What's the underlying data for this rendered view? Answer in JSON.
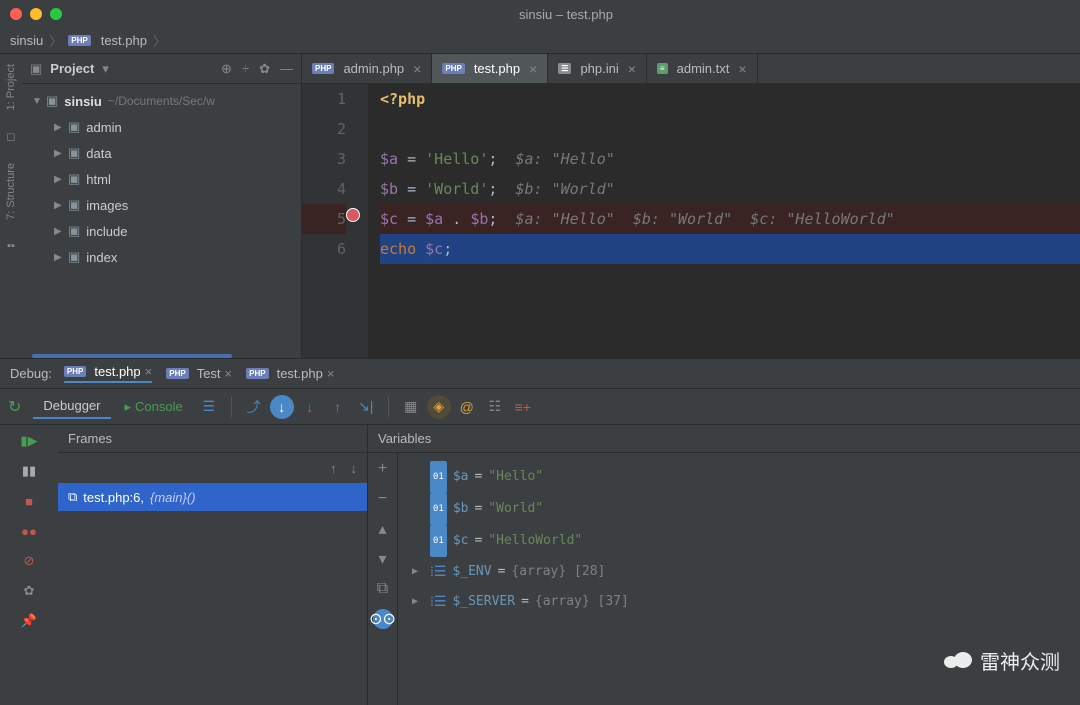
{
  "window": {
    "title": "sinsiu – test.php"
  },
  "breadcrumb": {
    "root": "sinsiu",
    "file": "test.php"
  },
  "project": {
    "panel_label": "Project",
    "root_name": "sinsiu",
    "root_path": "~/Documents/Sec/w",
    "folders": [
      "admin",
      "data",
      "html",
      "images",
      "include",
      "index"
    ]
  },
  "sidebar_strip": {
    "project": "1: Project",
    "structure": "7: Structure"
  },
  "editor_tabs": [
    {
      "label": "admin.php",
      "type": "php",
      "active": false
    },
    {
      "label": "test.php",
      "type": "php",
      "active": true
    },
    {
      "label": "php.ini",
      "type": "ini",
      "active": false
    },
    {
      "label": "admin.txt",
      "type": "txt",
      "active": false
    }
  ],
  "code": {
    "lines": [
      {
        "n": 1,
        "tag": "<?php"
      },
      {
        "n": 2,
        "raw": ""
      },
      {
        "n": 3,
        "var": "$a",
        "eq": " = ",
        "str": "'Hello'",
        "semi": ";",
        "hint": "  $a: \"Hello\""
      },
      {
        "n": 4,
        "var": "$b",
        "eq": " = ",
        "str": "'World'",
        "semi": ";",
        "hint": "  $b: \"World\""
      },
      {
        "n": 5,
        "bp": true,
        "var": "$c",
        "eq": " = ",
        "exprv1": "$a",
        "dot": " . ",
        "exprv2": "$b",
        "semi": ";",
        "hint": "  $a: \"Hello\"  $b: \"World\"  $c: \"HelloWorld\""
      },
      {
        "n": 6,
        "cur": true,
        "kw": "echo ",
        "var": "$c",
        "semi": ";"
      }
    ]
  },
  "debug": {
    "label": "Debug:",
    "tabs": [
      {
        "label": "test.php",
        "type": "php",
        "active": true
      },
      {
        "label": "Test",
        "type": "php",
        "active": false
      },
      {
        "label": "test.php",
        "type": "php",
        "active": false
      }
    ],
    "subtabs": {
      "debugger": "Debugger",
      "console": "Console"
    },
    "frames_label": "Frames",
    "variables_label": "Variables",
    "frame": {
      "file": "test.php:6,",
      "func": "{main}()"
    },
    "vars": [
      {
        "kind": "prim",
        "name": "$a",
        "value": "\"Hello\""
      },
      {
        "kind": "prim",
        "name": "$b",
        "value": "\"World\""
      },
      {
        "kind": "prim",
        "name": "$c",
        "value": "\"HelloWorld\""
      },
      {
        "kind": "arr",
        "name": "$_ENV",
        "value": "{array} [28]"
      },
      {
        "kind": "arr",
        "name": "$_SERVER",
        "value": "{array} [37]"
      }
    ]
  },
  "watermark": "雷神众测"
}
